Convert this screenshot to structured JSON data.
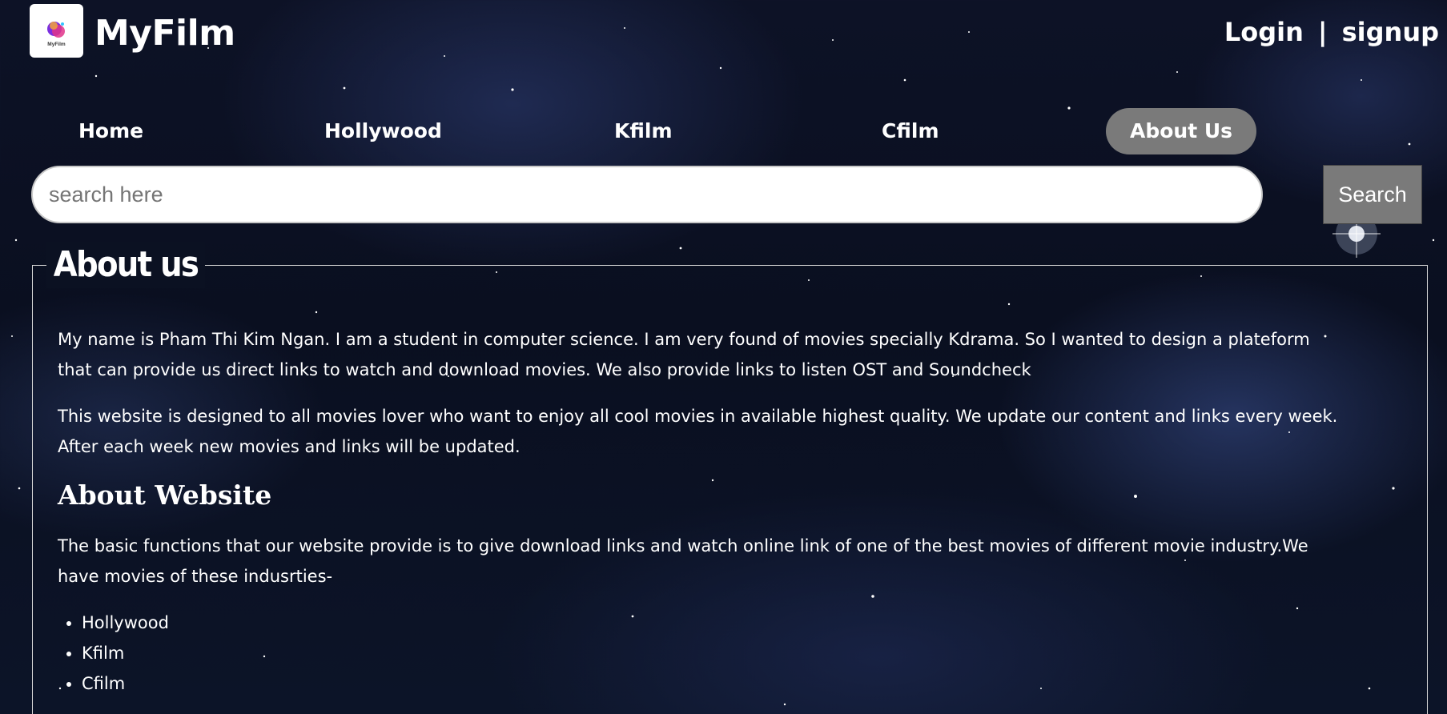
{
  "header": {
    "brand": "MyFilm",
    "logo_text": "MyFilm",
    "login_label": "Login",
    "separator": "|",
    "signup_label": "signup"
  },
  "nav": {
    "items": [
      {
        "label": "Home"
      },
      {
        "label": "Hollywood"
      },
      {
        "label": "Kfilm"
      },
      {
        "label": "Cfilm"
      },
      {
        "label": "About Us",
        "active": true
      }
    ]
  },
  "search": {
    "placeholder": "search here",
    "button_label": "Search"
  },
  "about": {
    "title": "About us",
    "paragraph1": "My name is Pham Thi Kim Ngan. I am a student in computer science. I am very found of movies specially Kdrama. So I wanted to design a plateform that can provide us direct links to watch and download movies. We also provide links to listen OST and Soundcheck",
    "paragraph2": "This website is designed to all movies lover who want to enjoy all cool movies in available highest quality. We update our content and links every week. After each week new movies and links will be updated.",
    "website_heading": "About Website",
    "paragraph3": "The basic functions that our website provide is to give download links and watch online link of one of the best movies of different movie industry.We have movies of these indusrties-",
    "industries": [
      "Hollywood",
      "Kfilm",
      "Cfilm"
    ]
  },
  "colors": {
    "active_tab": "#7a7a7a",
    "search_button": "#7a7a7a",
    "background": "#0d1226"
  }
}
